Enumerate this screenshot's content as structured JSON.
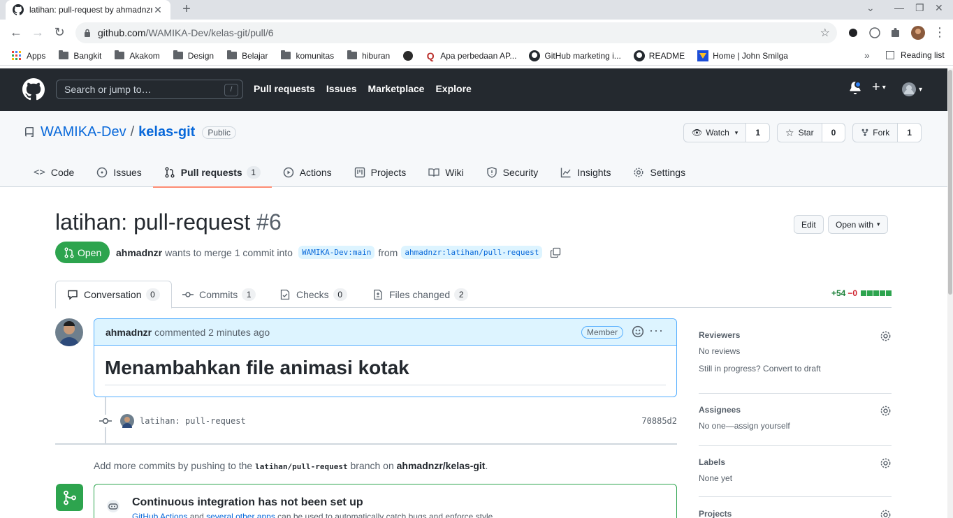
{
  "browser": {
    "tab_title": "latihan: pull-request by ahmadnzr",
    "url_host": "github.com",
    "url_path": "/WAMIKA-Dev/kelas-git/pull/6",
    "bookmarks": [
      "Apps",
      "Bangkit",
      "Akakom",
      "Design",
      "Belajar",
      "komunitas",
      "hiburan",
      "",
      "Apa perbedaan AP...",
      "GitHub marketing i...",
      "README",
      "Home | John Smilga"
    ],
    "reading_list": "Reading list"
  },
  "gh_header": {
    "search_placeholder": "Search or jump to…",
    "search_key": "/",
    "nav": [
      "Pull requests",
      "Issues",
      "Marketplace",
      "Explore"
    ]
  },
  "repo": {
    "owner": "WAMIKA-Dev",
    "separator": "/",
    "name": "kelas-git",
    "visibility": "Public",
    "watch_label": "Watch",
    "watch_count": "1",
    "star_label": "Star",
    "star_count": "0",
    "fork_label": "Fork",
    "fork_count": "1",
    "tabs": {
      "code": "Code",
      "issues": "Issues",
      "pulls": "Pull requests",
      "pulls_count": "1",
      "actions": "Actions",
      "projects": "Projects",
      "wiki": "Wiki",
      "security": "Security",
      "insights": "Insights",
      "settings": "Settings"
    }
  },
  "pr": {
    "title": "latihan: pull-request",
    "number": "#6",
    "edit_label": "Edit",
    "open_with_label": "Open with",
    "state": "Open",
    "author": "ahmadnzr",
    "merge_text": "wants to merge 1 commit into",
    "base_branch": "WAMIKA-Dev:main",
    "from_text": "from",
    "head_branch": "ahmadnzr:latihan/pull-request",
    "tabs": {
      "conversation": "Conversation",
      "conversation_count": "0",
      "commits": "Commits",
      "commits_count": "1",
      "checks": "Checks",
      "checks_count": "0",
      "files": "Files changed",
      "files_count": "2"
    },
    "additions": "+54",
    "deletions": "−0",
    "diff_blocks": 5
  },
  "comment": {
    "author": "ahmadnzr",
    "action": "commented 2 minutes ago",
    "badge": "Member",
    "heading": "Menambahkan file animasi kotak"
  },
  "commit": {
    "message": "latihan: pull-request",
    "sha": "70885d2"
  },
  "push_hint": {
    "before": "Add more commits by pushing to the",
    "branch": "latihan/pull-request",
    "middle": "branch on",
    "repo": "ahmadnzr/kelas-git",
    "after": "."
  },
  "ci": {
    "title": "Continuous integration has not been set up",
    "link1": "GitHub Actions",
    "and": "and",
    "link2": "several other apps",
    "rest": "can be used to automatically catch bugs and enforce style."
  },
  "sidebar": {
    "reviewers_title": "Reviewers",
    "reviewers_value": "No reviews",
    "reviewers_draft": "Still in progress? Convert to draft",
    "assignees_title": "Assignees",
    "assignees_value": "No one—assign yourself",
    "labels_title": "Labels",
    "labels_value": "None yet",
    "projects_title": "Projects"
  },
  "colors": {
    "header_bg": "#24292f",
    "open_green": "#2da44e",
    "link_blue": "#0969da",
    "underline_orange": "#fd8c73"
  }
}
